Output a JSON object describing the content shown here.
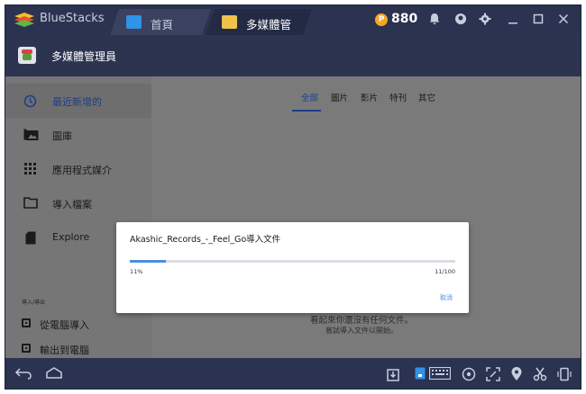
{
  "titlebar": {
    "app_name": "BlueStacks",
    "tabs": [
      {
        "label": "首頁",
        "icon": "home-icon"
      },
      {
        "label": "多媒體管",
        "icon": "folder-icon"
      }
    ],
    "coin_symbol": "P",
    "coins": "880",
    "icons": [
      "bell-icon",
      "account-icon",
      "gear-icon",
      "minimize-icon",
      "maximize-icon",
      "close-icon"
    ]
  },
  "header": {
    "title": "多媒體管理員"
  },
  "sidebar": {
    "items": [
      {
        "label": "最近新增的",
        "icon": "clock-icon",
        "active": true
      },
      {
        "label": "圖庫",
        "icon": "gallery-icon"
      },
      {
        "label": "應用程式媒介",
        "icon": "apps-grid-icon"
      },
      {
        "label": "導入檔案",
        "icon": "folder-icon"
      },
      {
        "label": "Explore",
        "icon": "sd-card-icon"
      }
    ],
    "section_label": "導入/導出",
    "actions": [
      {
        "label": "從電腦導入",
        "icon": "import-icon"
      },
      {
        "label": "輸出到電腦",
        "icon": "export-icon"
      }
    ]
  },
  "filters": {
    "tabs": [
      "全部",
      "圖片",
      "影片",
      "特刊",
      "其它"
    ],
    "active": "全部"
  },
  "empty_state": {
    "text": "看起來你還沒有任何文件。",
    "sub": "嘗試導入文件以開始。"
  },
  "dialog": {
    "title": "Akashic_Records_-_Feel_Go導入文件",
    "percent_label": "11%",
    "progress": 0.11,
    "count_label": "11/100",
    "cancel_label": "取消"
  },
  "bottombar": {
    "icons": [
      "back-icon",
      "home-icon",
      "apk-install-icon",
      "keyboard-toggle-icon",
      "keyboard-icon",
      "eye-icon",
      "fullscreen-icon",
      "location-icon",
      "screenshot-icon",
      "rotate-icon"
    ]
  },
  "colors": {
    "chrome": "#2b3350",
    "accent": "#1f3d86",
    "progress": "#4a8fe0",
    "overlay": "#7a7a7a"
  }
}
